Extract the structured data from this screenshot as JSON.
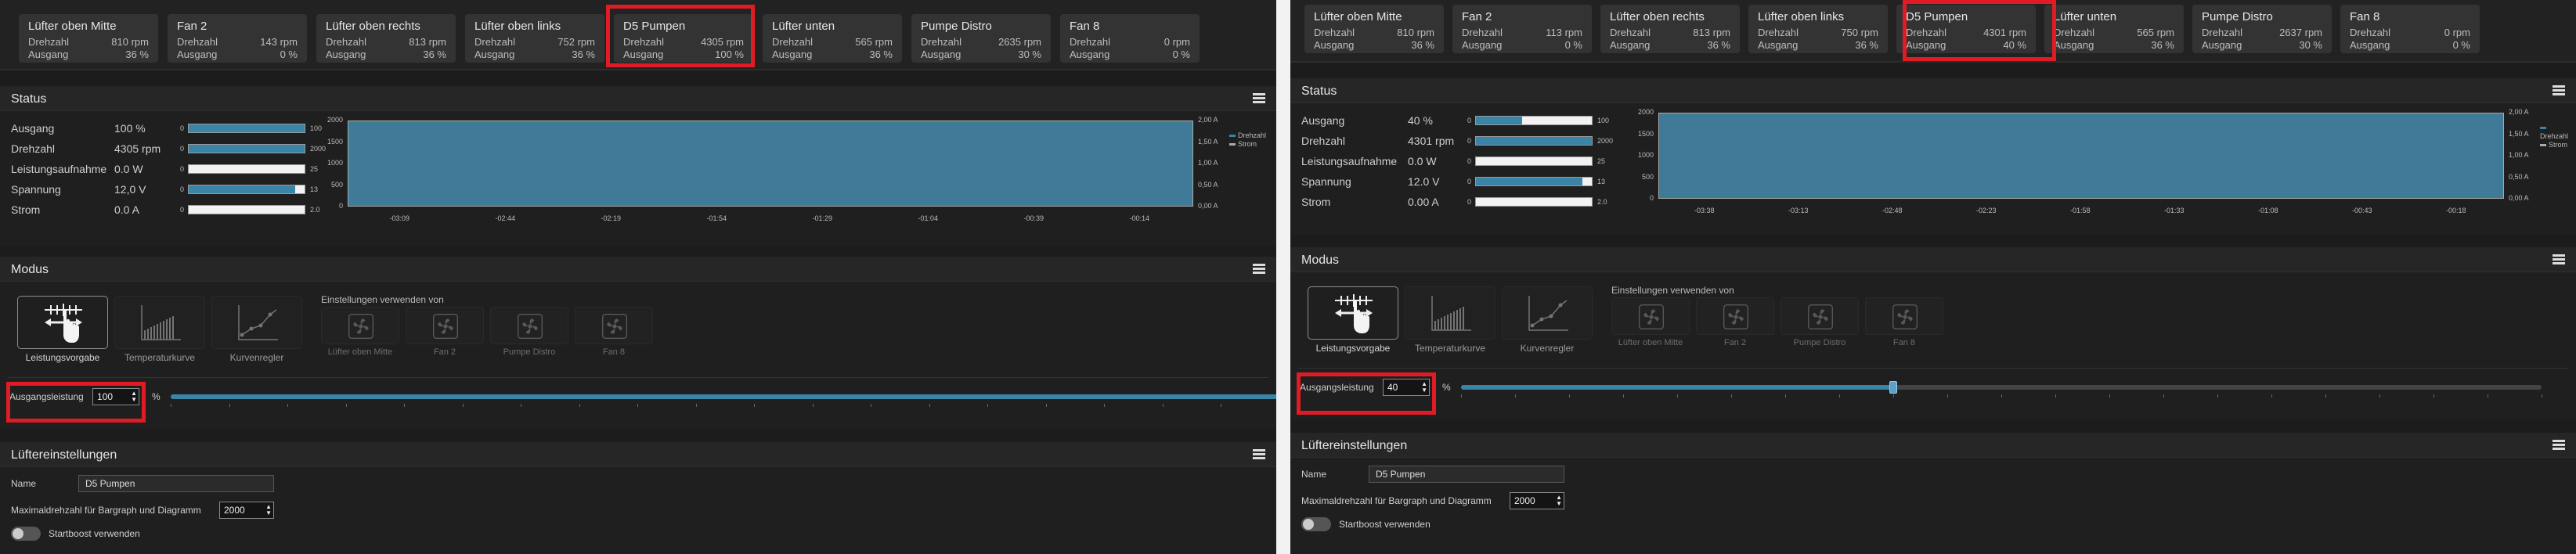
{
  "fans": [
    {
      "name": "Lüfter oben Mitte",
      "rpm_label": "Drehzahl",
      "out_label": "Ausgang"
    },
    {
      "name": "Fan 2",
      "rpm_label": "Drehzahl",
      "out_label": "Ausgang"
    },
    {
      "name": "Lüfter oben rechts",
      "rpm_label": "Drehzahl",
      "out_label": "Ausgang"
    },
    {
      "name": "Lüfter oben links",
      "rpm_label": "Drehzahl",
      "out_label": "Ausgang"
    },
    {
      "name": "D5 Pumpen",
      "rpm_label": "Drehzahl",
      "out_label": "Ausgang"
    },
    {
      "name": "Lüfter unten",
      "rpm_label": "Drehzahl",
      "out_label": "Ausgang"
    },
    {
      "name": "Pumpe Distro",
      "rpm_label": "Drehzahl",
      "out_label": "Ausgang"
    },
    {
      "name": "Fan 8",
      "rpm_label": "Drehzahl",
      "out_label": "Ausgang"
    }
  ],
  "status": {
    "title": "Status",
    "labels": [
      "Ausgang",
      "Drehzahl",
      "Leistungsaufnahme",
      "Spannung",
      "Strom"
    ],
    "bar_min": [
      "0",
      "0",
      "0",
      "0",
      "0"
    ],
    "bar_max": [
      "100",
      "2000",
      "25",
      "13",
      "2.0"
    ],
    "chart_y_left": [
      "2000",
      "1500",
      "1000",
      "500",
      "0"
    ],
    "chart_y_right": [
      "2,00 A",
      "1,50 A",
      "1,00 A",
      "0,50 A",
      "0,00 A"
    ],
    "legend": [
      "Drehzahl",
      "Strom"
    ]
  },
  "modus": {
    "title": "Modus",
    "modes": [
      "Leistungsvorgabe",
      "Temperaturkurve",
      "Kurvenregler"
    ],
    "settings_from": "Einstellungen verwenden von",
    "source_fans": [
      "Lüfter oben Mitte",
      "Fan 2",
      "Pumpe Distro",
      "Fan 8"
    ],
    "output_label": "Ausgangsleistung",
    "unit": "%"
  },
  "fan_settings": {
    "title": "Lüftereinstellungen",
    "name_label": "Name",
    "name_value": "D5 Pumpen",
    "maxrpm_label": "Maximaldrehzahl für Bargraph und Diagramm",
    "maxrpm_value": "2000",
    "startboost_label": "Startboost verwenden"
  },
  "left": {
    "fans": [
      {
        "rpm": "810 rpm",
        "out": "36 %"
      },
      {
        "rpm": "143 rpm",
        "out": "0 %"
      },
      {
        "rpm": "813 rpm",
        "out": "36 %"
      },
      {
        "rpm": "752 rpm",
        "out": "36 %"
      },
      {
        "rpm": "4305 rpm",
        "out": "100 %"
      },
      {
        "rpm": "565 rpm",
        "out": "36 %"
      },
      {
        "rpm": "2635 rpm",
        "out": "30 %"
      },
      {
        "rpm": "0 rpm",
        "out": "0 %"
      }
    ],
    "status_values": [
      "100 %",
      "4305 rpm",
      "0.0 W",
      "12,0 V",
      "0.0 A"
    ],
    "bar_fill": [
      1.0,
      1.0,
      0.0,
      0.92,
      0.0
    ],
    "x_ticks": [
      "-03:09",
      "-02:44",
      "-02:19",
      "-01:54",
      "-01:29",
      "-01:04",
      "-00:39",
      "-00:14"
    ],
    "output_value": "100",
    "output_fraction": 1.0
  },
  "right": {
    "fans": [
      {
        "rpm": "810 rpm",
        "out": "36 %"
      },
      {
        "rpm": "113 rpm",
        "out": "0 %"
      },
      {
        "rpm": "813 rpm",
        "out": "36 %"
      },
      {
        "rpm": "750 rpm",
        "out": "36 %"
      },
      {
        "rpm": "4301 rpm",
        "out": "40 %"
      },
      {
        "rpm": "565 rpm",
        "out": "36 %"
      },
      {
        "rpm": "2637 rpm",
        "out": "30 %"
      },
      {
        "rpm": "0 rpm",
        "out": "0 %"
      }
    ],
    "status_values": [
      "40 %",
      "4301 rpm",
      "0.0 W",
      "12.0 V",
      "0.00 A"
    ],
    "bar_fill": [
      0.4,
      1.0,
      0.0,
      0.92,
      0.0
    ],
    "x_ticks": [
      "-03:38",
      "-03:13",
      "-02:48",
      "-02:23",
      "-01:58",
      "-01:33",
      "-01:08",
      "-00:43",
      "-00:18"
    ],
    "output_value": "40",
    "output_fraction": 0.4
  },
  "colors": {
    "accent": "#3a84a8",
    "highlight": "#e01b24",
    "chart_fill": "#3f7b99"
  }
}
